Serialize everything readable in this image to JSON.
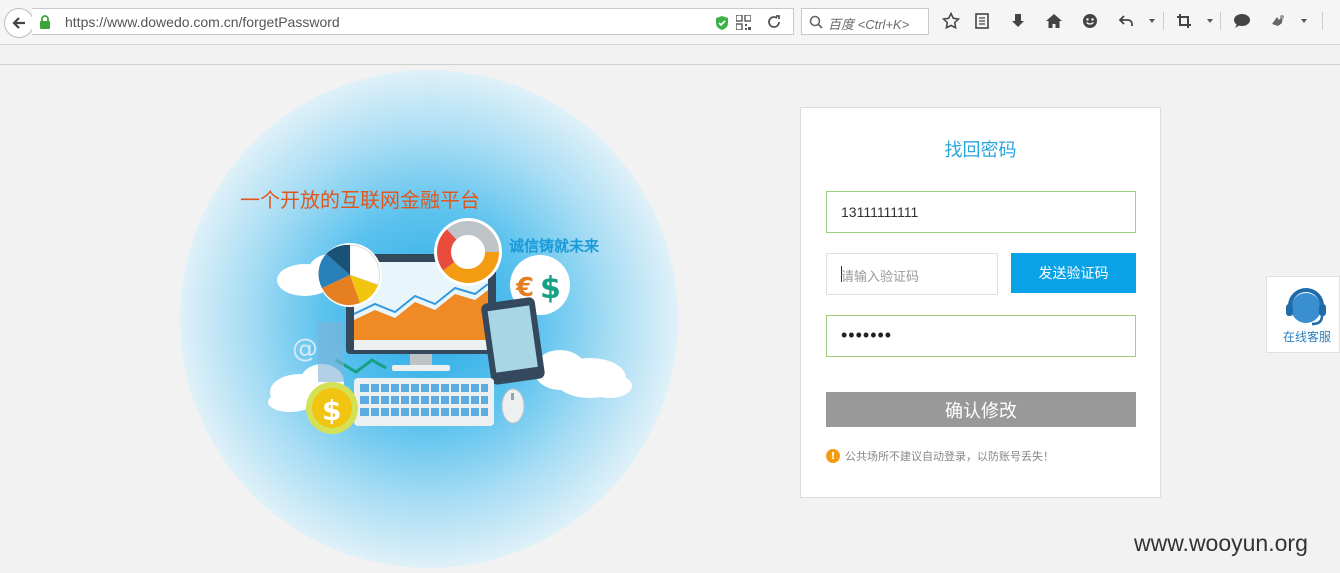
{
  "browser": {
    "url": "https://www.dowedo.com.cn/forgetPassword",
    "search_placeholder": "百度 <Ctrl+K>"
  },
  "illustration": {
    "slogan_main": "一个开放的互联网金融平台",
    "slogan_sub": "诚信铸就未来"
  },
  "form": {
    "title": "找回密码",
    "phone_value": "13111111111",
    "code_placeholder": "请输入验证码",
    "send_code_label": "发送验证码",
    "password_value": "•••••••",
    "confirm_label": "确认修改",
    "tip_text": "公共场所不建议自动登录，以防账号丢失！"
  },
  "customer_service": {
    "label": "在线客服"
  },
  "watermark": "www.wooyun.org",
  "colors": {
    "accent": "#0aa2e7",
    "title": "#2aa4dc",
    "valid_border": "#9ccf82",
    "disabled_button": "#999999",
    "slogan_orange": "#e2561c",
    "warning": "#f39c12"
  }
}
